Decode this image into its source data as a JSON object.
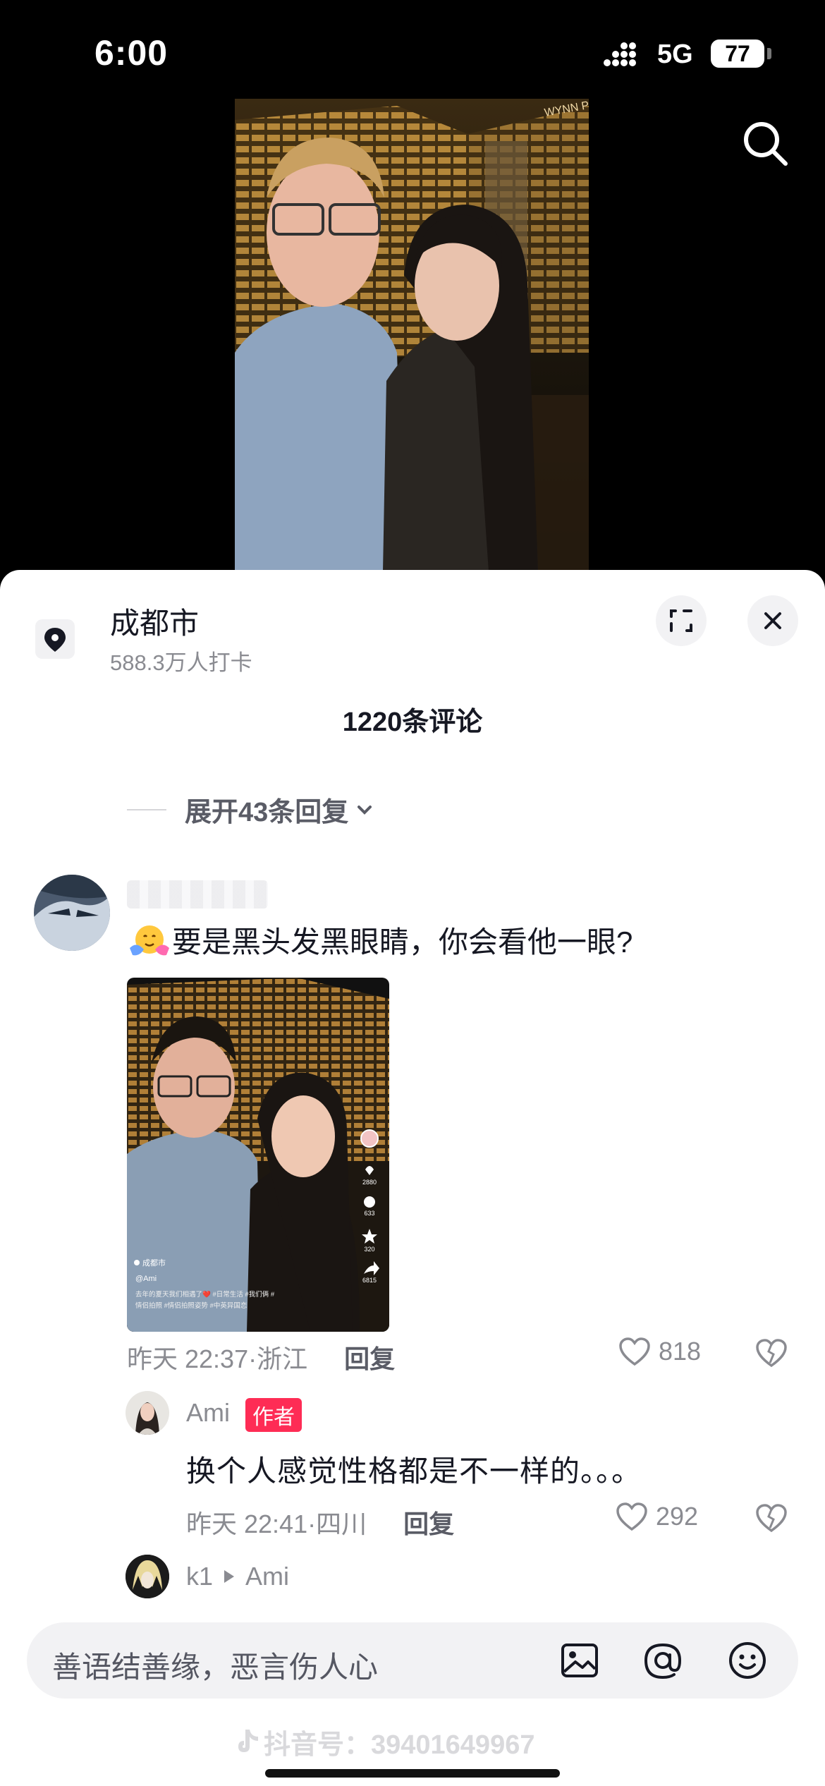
{
  "status_bar": {
    "time": "6:00",
    "network": "5G",
    "battery": "77"
  },
  "location": {
    "name": "成都市",
    "checkins": "588.3万人打卡"
  },
  "sheet": {
    "title": "1220条评论",
    "expand_replies": "展开43条回复"
  },
  "comment": {
    "text": "要是黑头发黑眼睛，你会看他一眼?",
    "time_place": "昨天 22:37·浙江",
    "reply_label": "回复",
    "likes": "818",
    "image": {
      "location": "成都市",
      "handle": "@Ami",
      "caption_line1": "去年的夏天我们相遇了❤️ #日常生活 #我们俩 #",
      "caption_line2": "情侣拍照 #情侣拍照姿势 #中英异国恋",
      "likes": "2880",
      "comments": "633",
      "favorites": "320",
      "shares": "6815"
    }
  },
  "reply": {
    "name": "Ami",
    "tag": "作者",
    "text": "换个人感觉性格都是不一样的。。。",
    "time_place": "昨天 22:41·四川",
    "reply_label": "回复",
    "likes": "292"
  },
  "reply2": {
    "name": "k1",
    "to": "Ami"
  },
  "input": {
    "placeholder": "善语结善缘，恶言伤人心"
  },
  "watermark": "抖音号：39401649967",
  "video_sign": "WYNN PALACE",
  "colors": {
    "accent": "#fe2c55",
    "text": "#161823",
    "secondary": "#8a8b91"
  }
}
